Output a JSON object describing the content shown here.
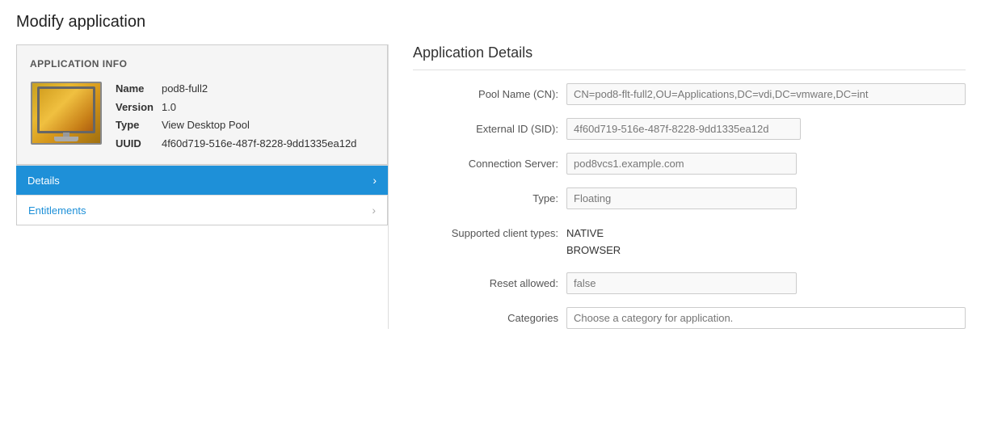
{
  "pageTitle": "Modify application",
  "leftPanel": {
    "appInfo": {
      "sectionTitle": "APPLICATION INFO",
      "fields": [
        {
          "label": "Name",
          "value": "pod8-full2"
        },
        {
          "label": "Version",
          "value": "1.0"
        },
        {
          "label": "Type",
          "value": "View Desktop Pool"
        },
        {
          "label": "UUID",
          "value": "4f60d719-516e-487f-8228-9dd1335ea12d"
        }
      ]
    },
    "navItems": [
      {
        "label": "Details",
        "active": true
      },
      {
        "label": "Entitlements",
        "active": false
      }
    ]
  },
  "rightPanel": {
    "title": "Application Details",
    "formRows": [
      {
        "label": "Pool Name (CN):",
        "type": "input",
        "value": "CN=pod8-flt-full2,OU=Applications,DC=vdi,DC=vmware,DC=int",
        "size": "wide"
      },
      {
        "label": "External ID (SID):",
        "type": "input",
        "value": "4f60d719-516e-487f-8228-9dd1335ea12d",
        "size": "medium"
      },
      {
        "label": "Connection Server:",
        "type": "input",
        "value": "pod8vcs1.example.com",
        "size": "short"
      },
      {
        "label": "Type:",
        "type": "input",
        "value": "Floating",
        "size": "short"
      },
      {
        "label": "Supported client types:",
        "type": "text",
        "lines": [
          "NATIVE",
          "BROWSER"
        ]
      },
      {
        "label": "Reset allowed:",
        "type": "input",
        "value": "false",
        "size": "short"
      },
      {
        "label": "Categories",
        "type": "categories",
        "placeholder": "Choose a category for application."
      }
    ]
  }
}
